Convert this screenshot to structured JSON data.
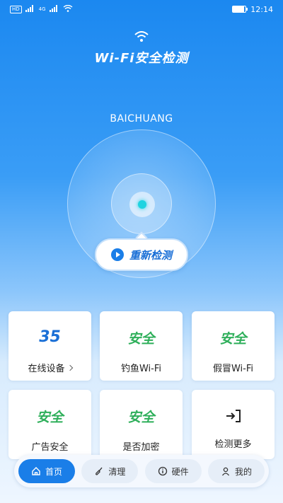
{
  "status_bar": {
    "badge": "HD",
    "signal_text": "4G",
    "time": "12:14",
    "battery_level": 0.85
  },
  "header": {
    "title": "Wi-Fi安全检测"
  },
  "ssid": "BAICHUANG",
  "rescan_label": "重新检测",
  "cards": [
    {
      "value": "35",
      "label": "在线设备"
    },
    {
      "value": "安全",
      "label": "钓鱼Wi-Fi"
    },
    {
      "value": "安全",
      "label": "假冒Wi-Fi"
    },
    {
      "value": "安全",
      "label": "广告安全"
    },
    {
      "value": "安全",
      "label": "是否加密"
    },
    {
      "label": "检测更多"
    }
  ],
  "nav": [
    {
      "label": "首页",
      "icon": "home-icon",
      "active": true
    },
    {
      "label": "清理",
      "icon": "broom-icon",
      "active": false
    },
    {
      "label": "硬件",
      "icon": "info-icon",
      "active": false
    },
    {
      "label": "我的",
      "icon": "user-icon",
      "active": false
    }
  ],
  "colors": {
    "primary": "#1a7ee8",
    "safe": "#2eaf5a",
    "radar_dot": "#1fd3e0"
  }
}
